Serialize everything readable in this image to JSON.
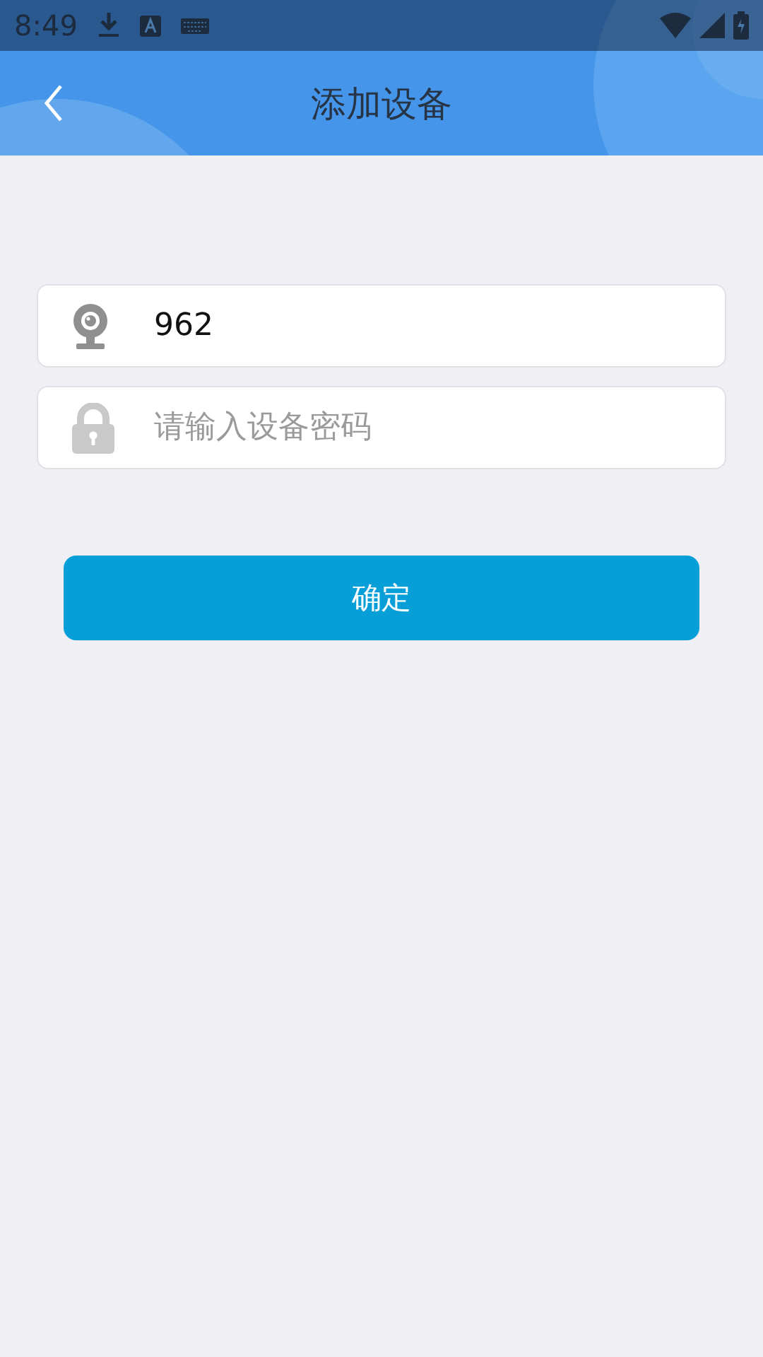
{
  "status_bar": {
    "time": "8:49"
  },
  "header": {
    "title": "添加设备"
  },
  "fields": [
    {
      "kind": "device",
      "value": "962"
    },
    {
      "kind": "password",
      "placeholder": "请输入设备密码"
    }
  ],
  "confirm_button": {
    "label": "确定"
  }
}
